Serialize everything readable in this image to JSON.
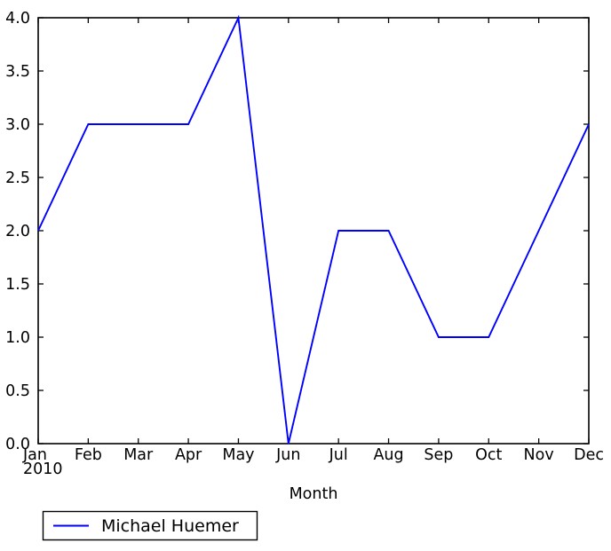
{
  "chart_data": {
    "type": "line",
    "title": "",
    "xlabel": "Month",
    "ylabel": "",
    "categories": [
      "Jan",
      "Feb",
      "Mar",
      "Apr",
      "May",
      "Jun",
      "Jul",
      "Aug",
      "Sep",
      "Oct",
      "Nov",
      "Dec"
    ],
    "x_sublabel": "2010",
    "series": [
      {
        "name": "Michael Huemer",
        "color": "#0000ff",
        "values": [
          2,
          3,
          3,
          3,
          4,
          0,
          2,
          2,
          1,
          1,
          2,
          3
        ]
      }
    ],
    "ylim": [
      0,
      4
    ],
    "yticks": [
      0,
      0.5,
      1,
      1.5,
      2,
      2.5,
      3,
      3.5,
      4
    ],
    "ytick_labels": [
      "0.0",
      "0.5",
      "1.0",
      "1.5",
      "2.0",
      "2.5",
      "3.0",
      "3.5",
      "4.0"
    ],
    "xticks": [
      0,
      1,
      2,
      3,
      4,
      5,
      6,
      7,
      8,
      9,
      10,
      11
    ],
    "xtick_labels": [
      "Jan",
      "Feb",
      "Mar",
      "Apr",
      "May",
      "Jun",
      "Jul",
      "Aug",
      "Sep",
      "Oct",
      "Nov",
      "Dec"
    ],
    "grid": false,
    "legend_position": "below-left",
    "legend_entries": [
      {
        "label": "Michael Huemer",
        "color": "#0000ff"
      }
    ]
  },
  "figure": {
    "background_color": "#ffffff",
    "axes_color": "#000000"
  }
}
